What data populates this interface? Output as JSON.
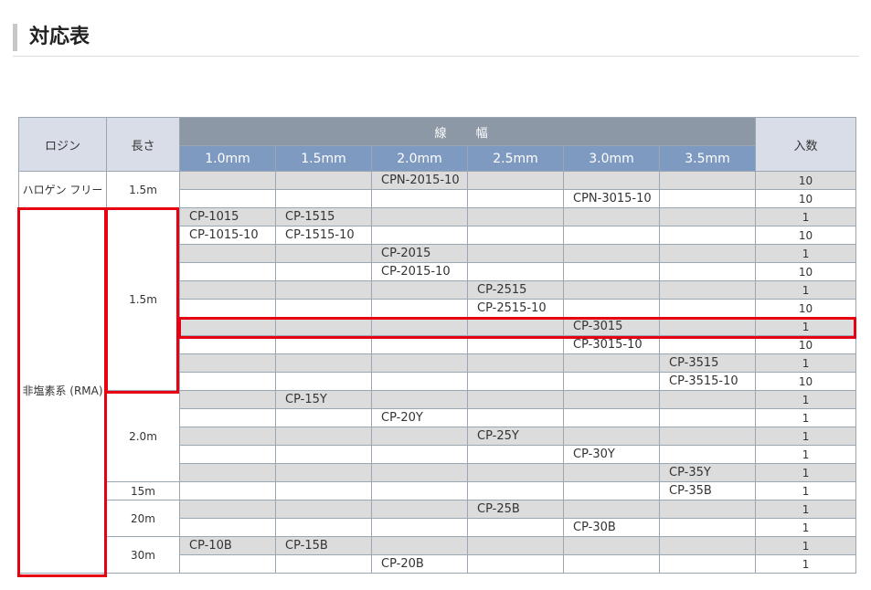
{
  "title": "対応表",
  "table": {
    "headers": {
      "rosin": "ロジン",
      "length": "長さ",
      "width_group": "線 幅",
      "quantity": "入数",
      "widths": [
        "1.0mm",
        "1.5mm",
        "2.0mm",
        "2.5mm",
        "3.0mm",
        "3.5mm"
      ]
    },
    "groups": {
      "halogen_free": "ハロゲン フリー",
      "rma": "非塩素系 (RMA)"
    },
    "lengths": {
      "l1": "1.5m",
      "l2": "1.5m",
      "l3": "2.0m",
      "l4": "15m",
      "l5": "20m",
      "l6": "30m"
    },
    "rows": [
      {
        "cells": [
          "",
          "",
          "CPN-2015-10",
          "",
          "",
          ""
        ],
        "qty": "10"
      },
      {
        "cells": [
          "",
          "",
          "",
          "",
          "CPN-3015-10",
          ""
        ],
        "qty": "10"
      },
      {
        "cells": [
          "CP-1015",
          "CP-1515",
          "",
          "",
          "",
          ""
        ],
        "qty": "1"
      },
      {
        "cells": [
          "CP-1015-10",
          "CP-1515-10",
          "",
          "",
          "",
          ""
        ],
        "qty": "10"
      },
      {
        "cells": [
          "",
          "",
          "CP-2015",
          "",
          "",
          ""
        ],
        "qty": "1"
      },
      {
        "cells": [
          "",
          "",
          "CP-2015-10",
          "",
          "",
          ""
        ],
        "qty": "10"
      },
      {
        "cells": [
          "",
          "",
          "",
          "CP-2515",
          "",
          ""
        ],
        "qty": "1"
      },
      {
        "cells": [
          "",
          "",
          "",
          "CP-2515-10",
          "",
          ""
        ],
        "qty": "10"
      },
      {
        "cells": [
          "",
          "",
          "",
          "",
          "CP-3015",
          ""
        ],
        "qty": "1"
      },
      {
        "cells": [
          "",
          "",
          "",
          "",
          "CP-3015-10",
          ""
        ],
        "qty": "10"
      },
      {
        "cells": [
          "",
          "",
          "",
          "",
          "",
          "CP-3515"
        ],
        "qty": "1"
      },
      {
        "cells": [
          "",
          "",
          "",
          "",
          "",
          "CP-3515-10"
        ],
        "qty": "10"
      },
      {
        "cells": [
          "",
          "CP-15Y",
          "",
          "",
          "",
          ""
        ],
        "qty": "1"
      },
      {
        "cells": [
          "",
          "",
          "CP-20Y",
          "",
          "",
          ""
        ],
        "qty": "1"
      },
      {
        "cells": [
          "",
          "",
          "",
          "CP-25Y",
          "",
          ""
        ],
        "qty": "1"
      },
      {
        "cells": [
          "",
          "",
          "",
          "",
          "CP-30Y",
          ""
        ],
        "qty": "1"
      },
      {
        "cells": [
          "",
          "",
          "",
          "",
          "",
          "CP-35Y"
        ],
        "qty": "1"
      },
      {
        "cells": [
          "",
          "",
          "",
          "",
          "",
          "CP-35B"
        ],
        "qty": "1"
      },
      {
        "cells": [
          "",
          "",
          "",
          "CP-25B",
          "",
          ""
        ],
        "qty": "1"
      },
      {
        "cells": [
          "",
          "",
          "",
          "",
          "CP-30B",
          ""
        ],
        "qty": "1"
      },
      {
        "cells": [
          "CP-10B",
          "CP-15B",
          "",
          "",
          "",
          ""
        ],
        "qty": "1"
      },
      {
        "cells": [
          "",
          "",
          "CP-20B",
          "",
          "",
          ""
        ],
        "qty": "1"
      }
    ]
  },
  "highlight_color": "#e60012"
}
